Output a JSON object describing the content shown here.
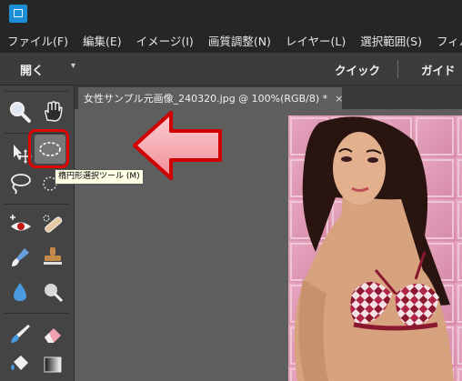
{
  "menu": [
    "ファイル(F)",
    "編集(E)",
    "イメージ(I)",
    "画質調整(N)",
    "レイヤー(L)",
    "選択範囲(S)",
    "フィル"
  ],
  "toolbar": {
    "open_label": "開く",
    "quick_label": "クイック",
    "guided_label": "ガイド"
  },
  "document": {
    "tab_title": "女性サンプル元画像_240320.jpg @ 100%(RGB/8) *",
    "close_glyph": "×"
  },
  "tooltip": {
    "text": "楕円形選択ツール (M)"
  },
  "colors": {
    "highlight": "#e10000",
    "arrow_fill": "#f4a0a6",
    "arrow_stroke": "#d00000",
    "app_icon": "#1a8fd6"
  },
  "icons": [
    "zoom-tool-icon",
    "hand-tool-icon",
    "move-tool-icon",
    "elliptical-marquee-tool-icon",
    "lasso-tool-icon",
    "quick-selection-tool-icon",
    "red-eye-removal-tool-icon",
    "spot-healing-brush-icon",
    "smart-brush-icon",
    "clone-stamp-icon",
    "blur-tool-icon",
    "sponge-tool-icon",
    "brush-tool-icon",
    "eraser-tool-icon",
    "paint-bucket-icon",
    "gradient-tool-icon"
  ]
}
